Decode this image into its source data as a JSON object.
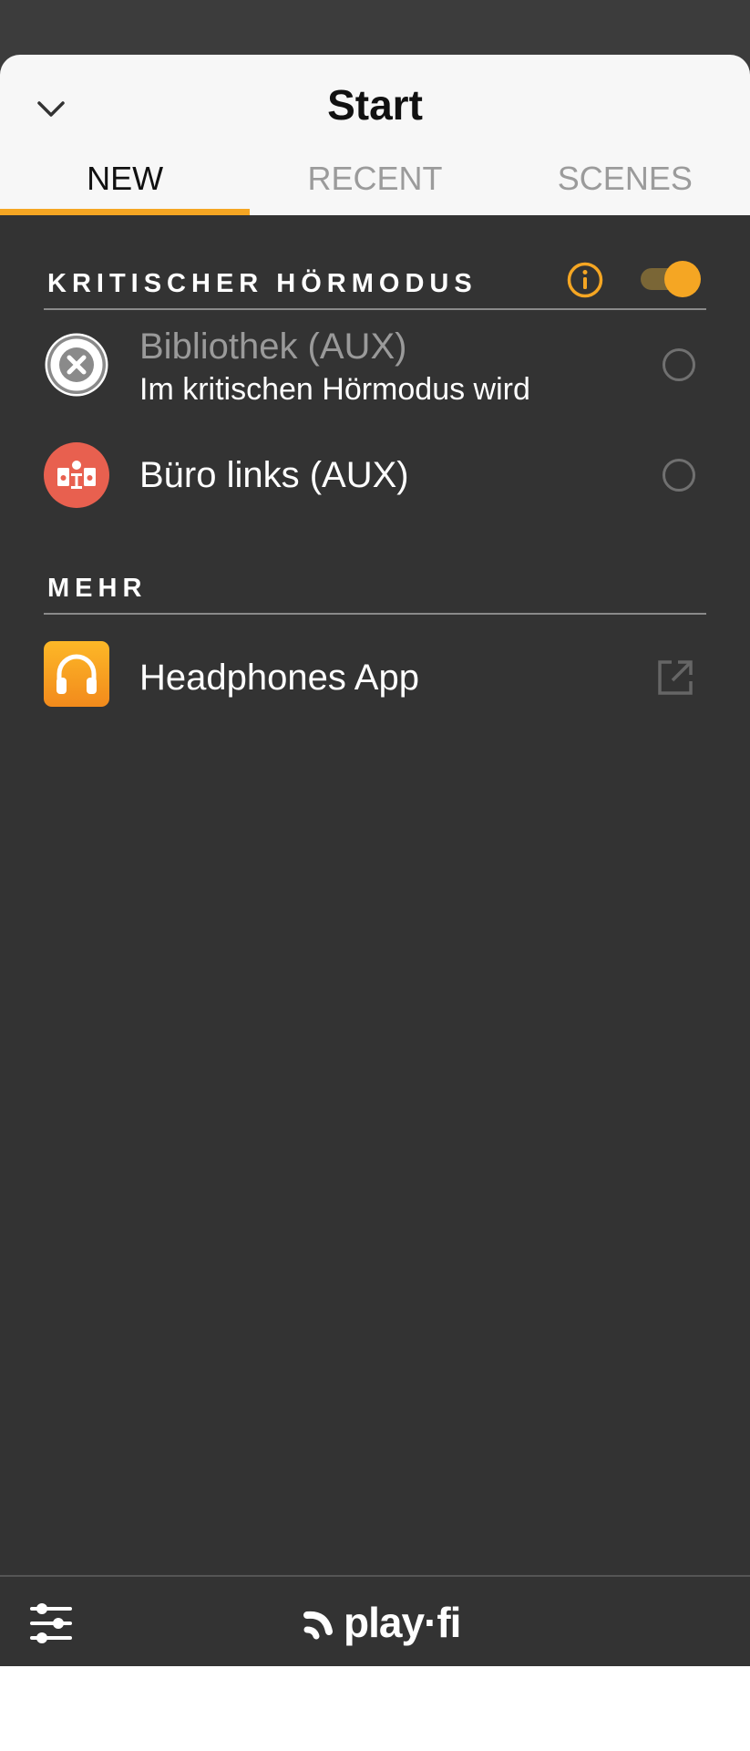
{
  "header": {
    "title": "Start",
    "tabs": [
      {
        "label": "NEW",
        "active": true
      },
      {
        "label": "RECENT",
        "active": false
      },
      {
        "label": "SCENES",
        "active": false
      }
    ]
  },
  "critical_mode": {
    "title": "KRITISCHER HÖRMODUS",
    "toggle_on": true,
    "items": [
      {
        "label": "Bibliothek (AUX)",
        "sublabel": "Im kritischen Hörmodus wird",
        "icon": "close-circle-icon",
        "disabled": true
      },
      {
        "label": "Büro links (AUX)",
        "icon": "speaker-icon",
        "disabled": false
      }
    ]
  },
  "more": {
    "title": "MEHR",
    "items": [
      {
        "label": "Headphones App",
        "icon": "headphones-icon"
      }
    ]
  },
  "footer": {
    "logo_text": "play·fi"
  },
  "colors": {
    "accent": "#f5a623",
    "background": "#333333",
    "header_bg": "#f7f7f7",
    "speaker_red": "#e8604f"
  }
}
